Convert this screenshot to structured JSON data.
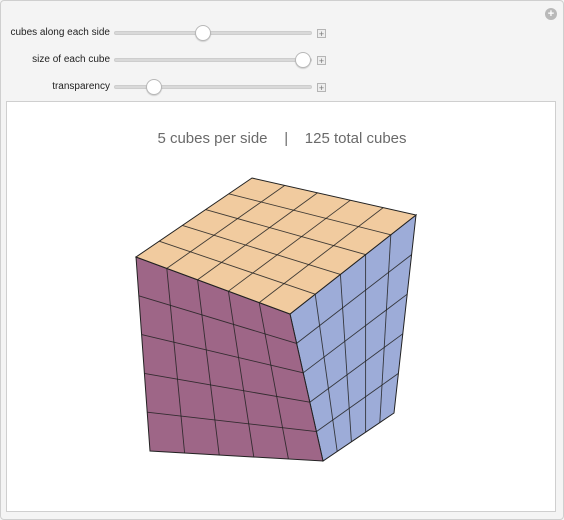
{
  "controls": [
    {
      "label": "cubes along each side",
      "value": 5,
      "min": 1,
      "max": 10,
      "position_fraction": 0.45
    },
    {
      "label": "size of each cube",
      "value": 1.0,
      "position_fraction": 1.0
    },
    {
      "label": "transparency",
      "value": 0.2,
      "position_fraction": 0.2
    }
  ],
  "step_symbol": "+",
  "corner_symbol": "+",
  "caption": {
    "per_side": "5 cubes per side",
    "separator": "|",
    "total": "125 total cubes"
  },
  "cube": {
    "n": 5,
    "top_color": "#f0c89a",
    "front_color": "#93557a",
    "right_color": "#98a8d6",
    "edge_color": "#222222"
  }
}
